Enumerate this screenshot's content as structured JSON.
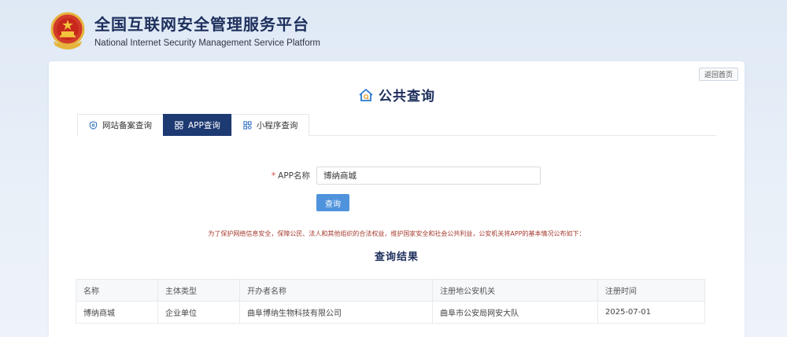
{
  "header": {
    "title_cn": "全国互联网安全管理服务平台",
    "title_en": "National Internet Security Management Service Platform"
  },
  "panel": {
    "back_label": "返回首页",
    "page_title": "公共查询",
    "tabs": [
      {
        "label": "网站备案查询",
        "icon": "shield-icon",
        "active": false
      },
      {
        "label": "APP查询",
        "icon": "grid-icon",
        "active": true
      },
      {
        "label": "小程序查询",
        "icon": "grid-icon",
        "active": false
      }
    ],
    "form": {
      "required_mark": "*",
      "label": "APP名称",
      "value": "博纳商城",
      "query_label": "查询"
    },
    "notice": "为了保护网络信息安全，保障公民、法人和其他组织的合法权益，维护国家安全和社会公共利益，公安机关将APP的基本情况公布如下：",
    "result_title": "查询结果",
    "table": {
      "headers": [
        "名称",
        "主体类型",
        "开办者名称",
        "注册地公安机关",
        "注册时间"
      ],
      "rows": [
        [
          "博纳商城",
          "企业单位",
          "曲阜博纳生物科技有限公司",
          "曲阜市公安局网安大队",
          "2025-07-01"
        ]
      ]
    }
  },
  "colors": {
    "brand_navy": "#1e3a73",
    "button_blue": "#4f93dc",
    "notice_red": "#a53b2e"
  }
}
